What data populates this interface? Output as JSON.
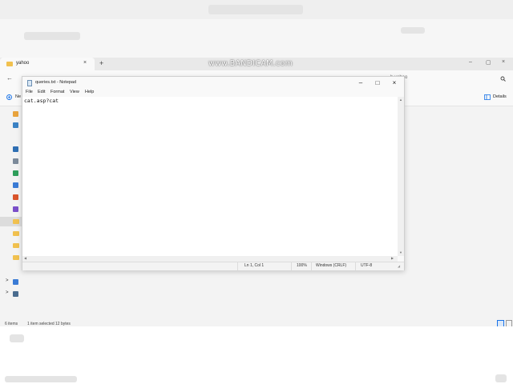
{
  "watermark": "www.BANDICAM.com",
  "explorer": {
    "tab_title": "yahoo",
    "tab_close": "×",
    "tab_add": "+",
    "back": "←",
    "search_placeholder": "h yahoo",
    "search_icon": "search-icon",
    "new_label": "Ne",
    "details_label": "Details",
    "window_controls": [
      "–",
      "▢",
      "×"
    ],
    "status": {
      "items": "6 items",
      "selected": "1 item selected  12 bytes"
    },
    "sidebar_expanders": [
      ">",
      ">"
    ]
  },
  "notepad": {
    "title": "queries.txt - Notepad",
    "minimize": "–",
    "maximize": "□",
    "close": "×",
    "menu": [
      "File",
      "Edit",
      "Format",
      "View",
      "Help"
    ],
    "content": "cat.asp?cat",
    "status": {
      "position": "Ln 1, Col 1",
      "zoom": "100%",
      "line_ending": "Windows (CRLF)",
      "encoding": "UTF-8"
    }
  },
  "colors": {
    "folder": "#f1c14f",
    "accent": "#1a73e8"
  }
}
